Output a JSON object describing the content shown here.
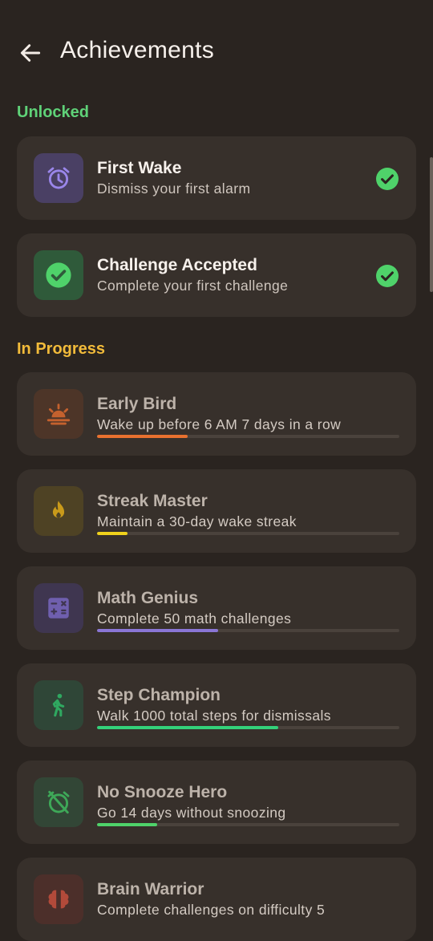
{
  "header": {
    "title": "Achievements"
  },
  "sections": {
    "unlocked": {
      "label": "Unlocked",
      "color": "#5fd278"
    },
    "in_progress": {
      "label": "In Progress",
      "color": "#f2bb3a"
    }
  },
  "unlocked": [
    {
      "title": "First Wake",
      "desc": "Dismiss your first alarm",
      "icon": "alarm-clock-icon",
      "completed": true
    },
    {
      "title": "Challenge Accepted",
      "desc": "Complete your first challenge",
      "icon": "check-circle-icon",
      "completed": true
    }
  ],
  "in_progress": [
    {
      "title": "Early Bird",
      "desc": "Wake up before 6 AM 7 days in a row",
      "icon": "sunrise-icon",
      "progress": 0.3,
      "color": "#e8712f"
    },
    {
      "title": "Streak Master",
      "desc": "Maintain a 30-day wake streak",
      "icon": "flame-icon",
      "progress": 0.1,
      "color": "#f0d21c"
    },
    {
      "title": "Math Genius",
      "desc": "Complete 50 math challenges",
      "icon": "calculator-icon",
      "progress": 0.4,
      "color": "#8a76d6"
    },
    {
      "title": "Step Champion",
      "desc": "Walk 1000 total steps for dismissals",
      "icon": "walking-icon",
      "progress": 0.6,
      "color": "#33d17a"
    },
    {
      "title": "No Snooze Hero",
      "desc": "Go 14 days without snoozing",
      "icon": "snooze-off-icon",
      "progress": 0.2,
      "color": "#4fd26a"
    },
    {
      "title": "Brain Warrior",
      "desc": "Complete challenges on difficulty 5",
      "icon": "brain-icon",
      "progress": 0.0,
      "color": "#d15a45"
    }
  ]
}
